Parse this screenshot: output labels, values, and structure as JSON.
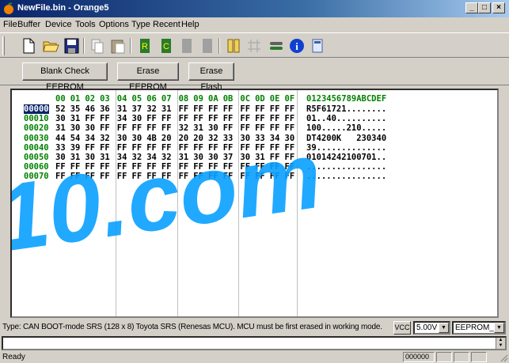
{
  "window": {
    "title": "NewFile.bin - Orange5"
  },
  "menu": [
    "File",
    "Buffer",
    "Device",
    "Tools",
    "Options",
    "Type",
    "Recent",
    "Help"
  ],
  "actions": {
    "blank_check": "Blank Check EEPROM",
    "erase_eeprom": "Erase EEPROM",
    "erase_flash": "Erase Flash"
  },
  "hex": {
    "column_headers": [
      "00",
      "01",
      "02",
      "03",
      "04",
      "05",
      "06",
      "07",
      "08",
      "09",
      "0A",
      "0B",
      "0C",
      "0D",
      "0E",
      "0F"
    ],
    "ascii_header": "0123456789ABCDEF",
    "rows": [
      {
        "address": "00000",
        "bytes": [
          "52",
          "35",
          "46",
          "36",
          "31",
          "37",
          "32",
          "31",
          "FF",
          "FF",
          "FF",
          "FF",
          "FF",
          "FF",
          "FF",
          "FF"
        ],
        "ascii": "R5F61721........"
      },
      {
        "address": "00010",
        "bytes": [
          "30",
          "31",
          "FF",
          "FF",
          "34",
          "30",
          "FF",
          "FF",
          "FF",
          "FF",
          "FF",
          "FF",
          "FF",
          "FF",
          "FF",
          "FF"
        ],
        "ascii": "01..40.........."
      },
      {
        "address": "00020",
        "bytes": [
          "31",
          "30",
          "30",
          "FF",
          "FF",
          "FF",
          "FF",
          "FF",
          "32",
          "31",
          "30",
          "FF",
          "FF",
          "FF",
          "FF",
          "FF"
        ],
        "ascii": "100.....210....."
      },
      {
        "address": "00030",
        "bytes": [
          "44",
          "54",
          "34",
          "32",
          "30",
          "30",
          "4B",
          "20",
          "20",
          "20",
          "32",
          "33",
          "30",
          "33",
          "34",
          "30"
        ],
        "ascii": "DT4200K   230340"
      },
      {
        "address": "00040",
        "bytes": [
          "33",
          "39",
          "FF",
          "FF",
          "FF",
          "FF",
          "FF",
          "FF",
          "FF",
          "FF",
          "FF",
          "FF",
          "FF",
          "FF",
          "FF",
          "FF"
        ],
        "ascii": "39.............."
      },
      {
        "address": "00050",
        "bytes": [
          "30",
          "31",
          "30",
          "31",
          "34",
          "32",
          "34",
          "32",
          "31",
          "30",
          "30",
          "37",
          "30",
          "31",
          "FF",
          "FF"
        ],
        "ascii": "01014242100701.."
      },
      {
        "address": "00060",
        "bytes": [
          "FF",
          "FF",
          "FF",
          "FF",
          "FF",
          "FF",
          "FF",
          "FF",
          "FF",
          "FF",
          "FF",
          "FF",
          "FF",
          "FF",
          "FF",
          "FF"
        ],
        "ascii": "................"
      },
      {
        "address": "00070",
        "bytes": [
          "FF",
          "FF",
          "FF",
          "FF",
          "FF",
          "FF",
          "FF",
          "FF",
          "FF",
          "FF",
          "FF",
          "FF",
          "FF",
          "FF",
          "FF",
          "FF"
        ],
        "ascii": "................"
      }
    ],
    "selected_address": "00000"
  },
  "watermark": {
    "text": "10.com",
    "color": "#0aa0ff"
  },
  "device_info": {
    "type_text": "Type: CAN BOOT-mode SRS (128 x 8)  Toyota SRS (Renesas MCU). MCU must be first erased in working mode.",
    "vcc_label": "VCC",
    "voltage": "5.00V",
    "mode": "EEPROM_II"
  },
  "status": {
    "ready": "Ready",
    "counter": "000000"
  },
  "colors": {
    "title_start": "#0a246a",
    "title_end": "#a6caf0",
    "address": "#008000",
    "face": "#d4d0c8"
  },
  "icons": [
    "new-file-icon",
    "open-folder-icon",
    "save-icon",
    "copy-icon",
    "paste-icon",
    "read-chip-icon",
    "write-chip-icon",
    "verify-chip-icon",
    "erase-chip-icon",
    "device-select-icon",
    "grid-icon",
    "settings-icon",
    "info-icon",
    "calculator-icon"
  ]
}
